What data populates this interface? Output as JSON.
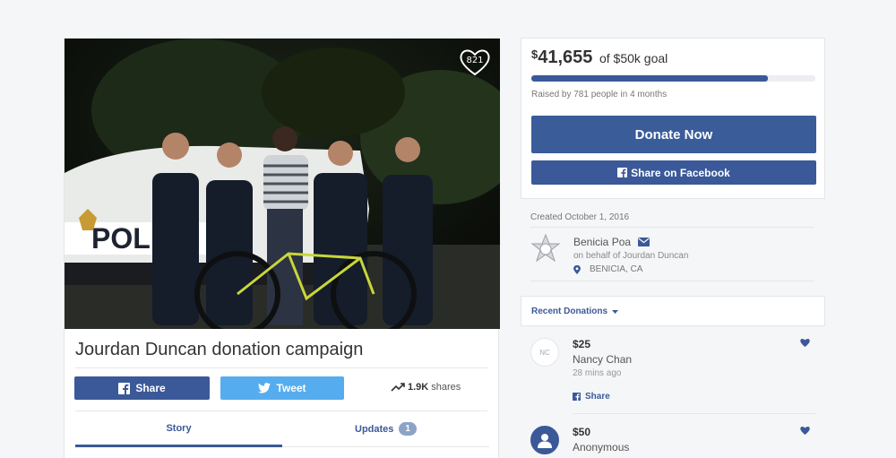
{
  "photo": {
    "like_count": "821"
  },
  "campaign": {
    "title": "Jourdan Duncan donation campaign",
    "share_label": "Share",
    "tweet_label": "Tweet",
    "shares_count": "1.9K",
    "shares_suffix": "shares",
    "tabs": [
      {
        "label": "Story",
        "active": true
      },
      {
        "label": "Updates",
        "badge": "1",
        "active": false
      }
    ]
  },
  "goal": {
    "currency": "$",
    "raised": "41,655",
    "goal_text": "of $50k goal",
    "progress_fraction": 0.833,
    "raised_by": "Raised by 781 people in 4 months",
    "donate_label": "Donate Now",
    "fb_share_label": "Share on Facebook"
  },
  "organizer": {
    "created": "Created October 1, 2016",
    "name": "Benicia Poa",
    "behalf": "on behalf of Jourdan Duncan",
    "location": "BENICIA, CA"
  },
  "recent": {
    "label": "Recent Donations",
    "items": [
      {
        "initials": "NC",
        "amount": "$25",
        "name": "Nancy Chan",
        "time": "28 mins ago",
        "share_label": "Share"
      },
      {
        "initials": "",
        "amount": "$50",
        "name": "Anonymous",
        "time": "",
        "share_label": ""
      }
    ]
  },
  "colors": {
    "facebook": "#3b5998",
    "twitter": "#55acee",
    "donate": "#3a5c99"
  },
  "icons": [
    "heart-icon",
    "facebook-icon",
    "twitter-icon",
    "trending-up-icon",
    "mail-icon",
    "location-pin-icon",
    "caret-down-icon",
    "person-icon",
    "police-star-icon"
  ]
}
